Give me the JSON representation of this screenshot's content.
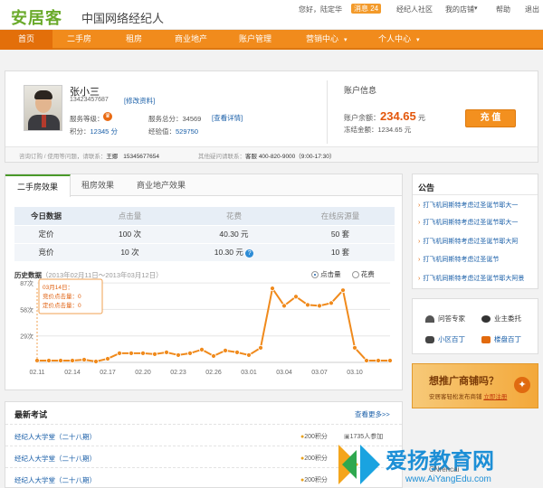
{
  "app": {
    "logo": "安居客",
    "subtitle": "中国网络经纪人"
  },
  "topbar": {
    "greeting": "您好，陆定华",
    "messages": "消息 24",
    "community": "经纪人社区",
    "my_store": "我的店铺",
    "help": "帮助",
    "logout": "退出"
  },
  "nav": [
    "首页",
    "二手房",
    "租房",
    "商业地产",
    "账户管理",
    "营销中心",
    "个人中心"
  ],
  "account": {
    "name": "张小三",
    "phone": "13423457687",
    "edit_link": "[修改资料]",
    "service_level_label": "服务等级：",
    "service_score_label": "服务总分：",
    "service_score": "34569",
    "detail_link": "[查看详情]",
    "points_label": "积分：",
    "points": "12345 分",
    "experience_label": "经验值：",
    "experience": "529750",
    "account_info_title": "账户信息",
    "balance_label": "账户余额：",
    "balance": "234.65",
    "balance_unit": "元",
    "frozen_label": "冻结金额：",
    "frozen": "1234.65 元",
    "recharge_button": "充 值",
    "info_bar_left": "咨询订购 / 使用等问题，请联系：",
    "contact_name": "王娜",
    "contact_phone": "15345677654",
    "info_bar_right": "其他疑问请联系：",
    "hotline_label": "客服",
    "hotline": "400-820-9000（9:00-17:30）"
  },
  "stats": {
    "tabs": [
      "二手房效果",
      "租房效果",
      "商业地产效果"
    ],
    "headers": [
      "今日数据",
      "点击量",
      "花费",
      "在线房源量"
    ],
    "rows": [
      {
        "label": "定价",
        "clicks": "100 次",
        "cost": "40.30 元",
        "listings": "50 套"
      },
      {
        "label": "竞价",
        "clicks": "10 次",
        "cost": "10.30 元",
        "listings": "10 套"
      }
    ],
    "history_label": "历史数据",
    "history_range": "（2013年02月11日～2013年03月12日）",
    "radio_clicks": "点击量",
    "radio_cost": "花费"
  },
  "chart_data": {
    "type": "line",
    "yticks": [
      "87次",
      "58次",
      "29次"
    ],
    "xticks": [
      "02.11",
      "02.14",
      "02.17",
      "02.20",
      "02.23",
      "02.26",
      "03.01",
      "03.04",
      "03.07",
      "03.10"
    ],
    "series": [
      {
        "values": [
          2,
          2,
          2,
          2,
          3,
          1,
          4,
          10,
          10,
          10,
          9,
          11,
          8,
          10,
          14,
          7,
          13,
          11,
          8,
          16,
          81,
          62,
          72,
          63,
          62,
          65,
          79,
          16,
          2,
          2,
          2
        ]
      }
    ],
    "ylim": [
      0,
      95
    ],
    "color": "#f08a1c",
    "tooltip": {
      "date": "03月14日：",
      "bid_clicks": "竞价点击量：0",
      "fixed_clicks": "定价点击量：0"
    }
  },
  "exams": {
    "title": "最新考试",
    "more": "查看更多>>",
    "items": [
      {
        "name": "经纪人大学堂（二十八期）",
        "points": "200积分",
        "participants": "1735人参加"
      },
      {
        "name": "经纪人大学堂（二十八期）",
        "points": "200积分",
        "participants": ""
      },
      {
        "name": "经纪人大学堂（二十八期）",
        "points": "200积分",
        "participants": ""
      }
    ]
  },
  "notice": {
    "title": "公告",
    "items": [
      "打飞机同斯特考虑过圣诞节耶大一",
      "打飞机同斯特考虑过圣诞节耶大一",
      "打飞机同斯特考虑过圣诞节耶大阿",
      "打飞机同斯特考虑过圣诞节",
      "打飞机同斯特考虑过圣诞节耶大阿景"
    ]
  },
  "quick": [
    "问答专家",
    "业主委托",
    "小区百丁",
    "楼盘百丁"
  ],
  "promo": {
    "title": "想推广商铺吗？",
    "sub": "安居客轻松发布商铺",
    "link": "立即注册"
  },
  "watermark": {
    "text": "爱扬教育网",
    "url": "www.AiYangEdu.com",
    "tag": "CNrencai"
  }
}
